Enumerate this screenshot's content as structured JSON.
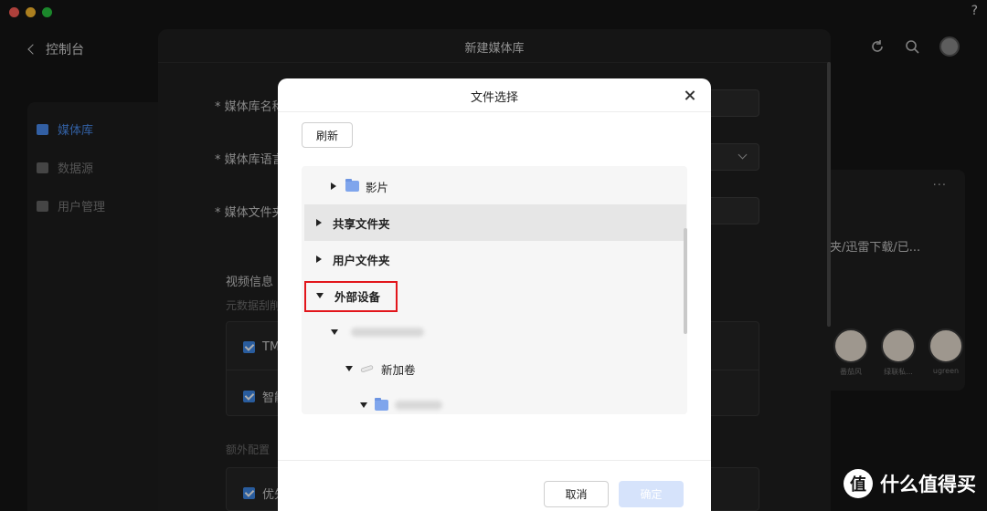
{
  "colors": {
    "close": "#ff5f57",
    "minimize": "#febc2e",
    "zoom": "#28c840",
    "accent": "#3d88e8",
    "highlight": "#e2161c"
  },
  "titlebar": {
    "help": "?"
  },
  "app": {
    "back_label": "控制台",
    "sidebar": [
      {
        "label": "媒体库",
        "icon": "library-icon",
        "active": true
      },
      {
        "label": "数据源",
        "icon": "datasource-icon",
        "active": false
      },
      {
        "label": "用户管理",
        "icon": "users-icon",
        "active": false
      }
    ],
    "right_panel": {
      "more": "···",
      "path_text": "夹/迅雷下载/已...",
      "users": [
        "番茄风",
        "绿联私...",
        "ugreen"
      ]
    }
  },
  "sheet": {
    "title": "新建媒体库",
    "fields": [
      {
        "label": "媒体库名称"
      },
      {
        "label": "媒体库语言"
      },
      {
        "label": "媒体文件夹"
      }
    ],
    "section_video": "视频信息",
    "section_video_sub": "元数据刮削",
    "video_options": [
      "TM",
      "智能"
    ],
    "section_extra": "额外配置",
    "extra_options": [
      "优先"
    ]
  },
  "dialog": {
    "title": "文件选择",
    "refresh_label": "刷新",
    "tree": [
      {
        "label": "影片",
        "expanded": false,
        "type": "folder"
      },
      {
        "label": "共享文件夹",
        "expanded": false,
        "type": "root"
      },
      {
        "label": "用户文件夹",
        "expanded": false,
        "type": "root"
      },
      {
        "label": "外部设备",
        "expanded": true,
        "type": "root",
        "highlighted": true
      },
      {
        "label": "",
        "expanded": true,
        "type": "device",
        "blurred": true
      },
      {
        "label": "新加卷",
        "expanded": true,
        "type": "drive"
      },
      {
        "label": "",
        "expanded": true,
        "type": "folder",
        "blurred": true
      }
    ],
    "cancel_label": "取消",
    "ok_label": "确定"
  },
  "watermark": {
    "icon": "值",
    "text": "什么值得买"
  }
}
